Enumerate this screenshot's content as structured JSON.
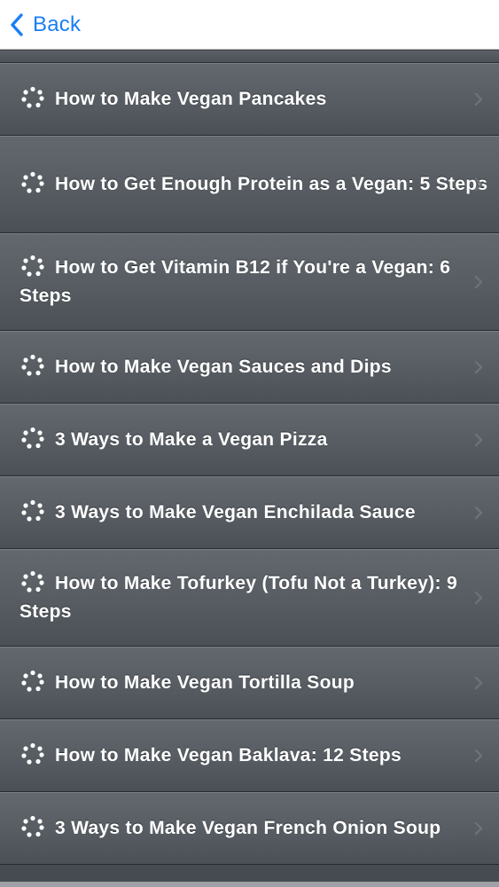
{
  "nav": {
    "back_label": "Back"
  },
  "colors": {
    "accent": "#1a7ef7",
    "row_bg": "#565c62",
    "row_text": "#ffffff"
  },
  "list": {
    "items": [
      {
        "label": "How to Make Vegan Pancakes",
        "icon": "spinner-icon",
        "lines": 1
      },
      {
        "label": "How to Get Enough Protein as a Vegan: 5 Steps",
        "icon": "spinner-icon",
        "lines": 2
      },
      {
        "label": "How to Get Vitamin B12 if You're a Vegan: 6 Steps",
        "icon": "spinner-icon",
        "lines": 2
      },
      {
        "label": "How to Make Vegan Sauces and Dips",
        "icon": "spinner-icon",
        "lines": 1
      },
      {
        "label": "3 Ways to Make a Vegan Pizza",
        "icon": "spinner-icon",
        "lines": 1
      },
      {
        "label": "3 Ways to Make Vegan Enchilada Sauce",
        "icon": "spinner-icon",
        "lines": 1
      },
      {
        "label": "How to Make Tofurkey (Tofu Not a Turkey): 9 Steps",
        "icon": "spinner-icon",
        "lines": 2
      },
      {
        "label": "How to Make Vegan Tortilla Soup",
        "icon": "spinner-icon",
        "lines": 1
      },
      {
        "label": "How to Make Vegan Baklava: 12 Steps",
        "icon": "spinner-icon",
        "lines": 1
      },
      {
        "label": "3 Ways to Make Vegan French Onion Soup",
        "icon": "spinner-icon",
        "lines": 1
      }
    ]
  }
}
